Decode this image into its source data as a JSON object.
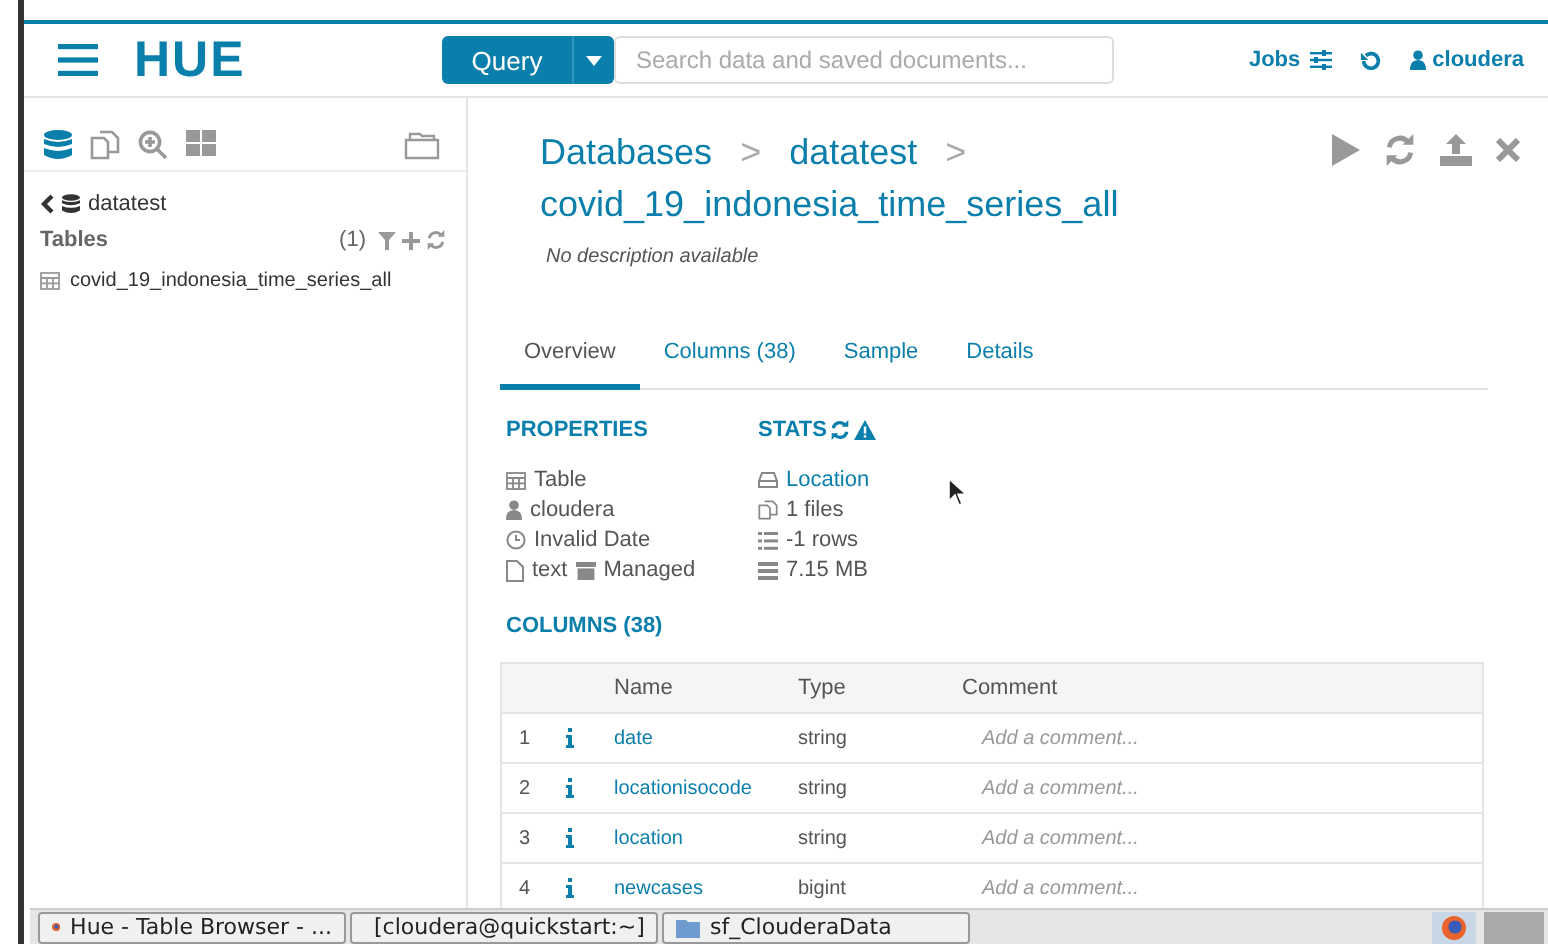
{
  "header": {
    "logo": "HUE",
    "query_button": "Query",
    "search": {
      "placeholder": "Search data and saved documents..."
    },
    "jobs": "Jobs",
    "user": "cloudera"
  },
  "sidebar": {
    "icons": [
      {
        "kind": "database",
        "selected": true
      },
      {
        "kind": "documents",
        "selected": false
      },
      {
        "kind": "zoom",
        "selected": false
      },
      {
        "kind": "grid",
        "selected": false
      }
    ],
    "back_label": "datatest",
    "section": "Tables",
    "count": "(1)",
    "tables": [
      "covid_19_indonesia_time_series_all"
    ]
  },
  "breadcrumb": [
    "Databases",
    ">",
    "datatest",
    ">",
    "covid_19_indonesia_time_series_all"
  ],
  "description": "No description available",
  "tabs": [
    {
      "label": "Overview",
      "selected": true
    },
    {
      "label": "Columns (38)",
      "selected": false
    },
    {
      "label": "Sample",
      "selected": false
    },
    {
      "label": "Details",
      "selected": false
    }
  ],
  "properties": {
    "title": "PROPERTIES",
    "items": [
      {
        "kind": "table",
        "text": "Table"
      },
      {
        "kind": "user",
        "text": "cloudera"
      },
      {
        "kind": "clock",
        "text": "Invalid Date"
      },
      {
        "kind": "file",
        "text": "text"
      }
    ],
    "managed": "Managed"
  },
  "stats": {
    "title": "STATS",
    "items": [
      {
        "kind": "location",
        "text": "Location",
        "link": true
      },
      {
        "kind": "files",
        "text": "1 files",
        "link": false
      },
      {
        "kind": "rows",
        "text": "-1 rows",
        "link": false
      },
      {
        "kind": "size",
        "text": "7.15 MB",
        "link": false
      }
    ]
  },
  "columns": {
    "title": "COLUMNS (38)",
    "headers": [
      "Name",
      "Type",
      "Comment"
    ],
    "rows": [
      {
        "index": "1",
        "name": "date",
        "type": "string",
        "comment_placeholder": "Add a comment..."
      },
      {
        "index": "2",
        "name": "locationisocode",
        "type": "string",
        "comment_placeholder": "Add a comment..."
      },
      {
        "index": "3",
        "name": "location",
        "type": "string",
        "comment_placeholder": "Add a comment..."
      },
      {
        "index": "4",
        "name": "newcases",
        "type": "bigint",
        "comment_placeholder": "Add a comment..."
      }
    ]
  },
  "taskbar": [
    {
      "kind": "browser",
      "label": "Hue - Table Browser - ..."
    },
    {
      "kind": "terminal",
      "label": "[cloudera@quickstart:~]"
    },
    {
      "kind": "folder",
      "label": "sf_ClouderaData"
    }
  ]
}
